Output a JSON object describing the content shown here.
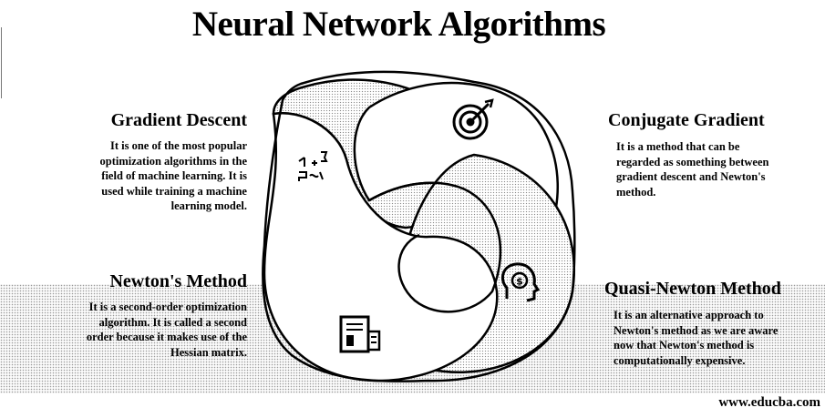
{
  "title": "Neural Network Algorithms",
  "items": [
    {
      "title": "Gradient Descent",
      "description": "It is one of the most popular optimization algorithms in the field of machine learning. It is used while training a machine learning model.",
      "icon": "formula-icon"
    },
    {
      "title": "Conjugate Gradient",
      "description": "It is a method that can be regarded as something between gradient descent and Newton's method.",
      "icon": "target-icon"
    },
    {
      "title": "Newton's Method",
      "description": "It is a second-order optimization algorithm. It is called a second order because it makes use of the Hessian matrix.",
      "icon": "report-icon"
    },
    {
      "title": "Quasi-Newton Method",
      "description": "It is an alternative approach to Newton's method as we are aware now that Newton's method is computationally expensive.",
      "icon": "head-dollar-icon"
    }
  ],
  "footer": "www.educba.com",
  "colors": {
    "ink": "#000000",
    "background": "#ffffff",
    "stipple": "#9a9a9a"
  }
}
